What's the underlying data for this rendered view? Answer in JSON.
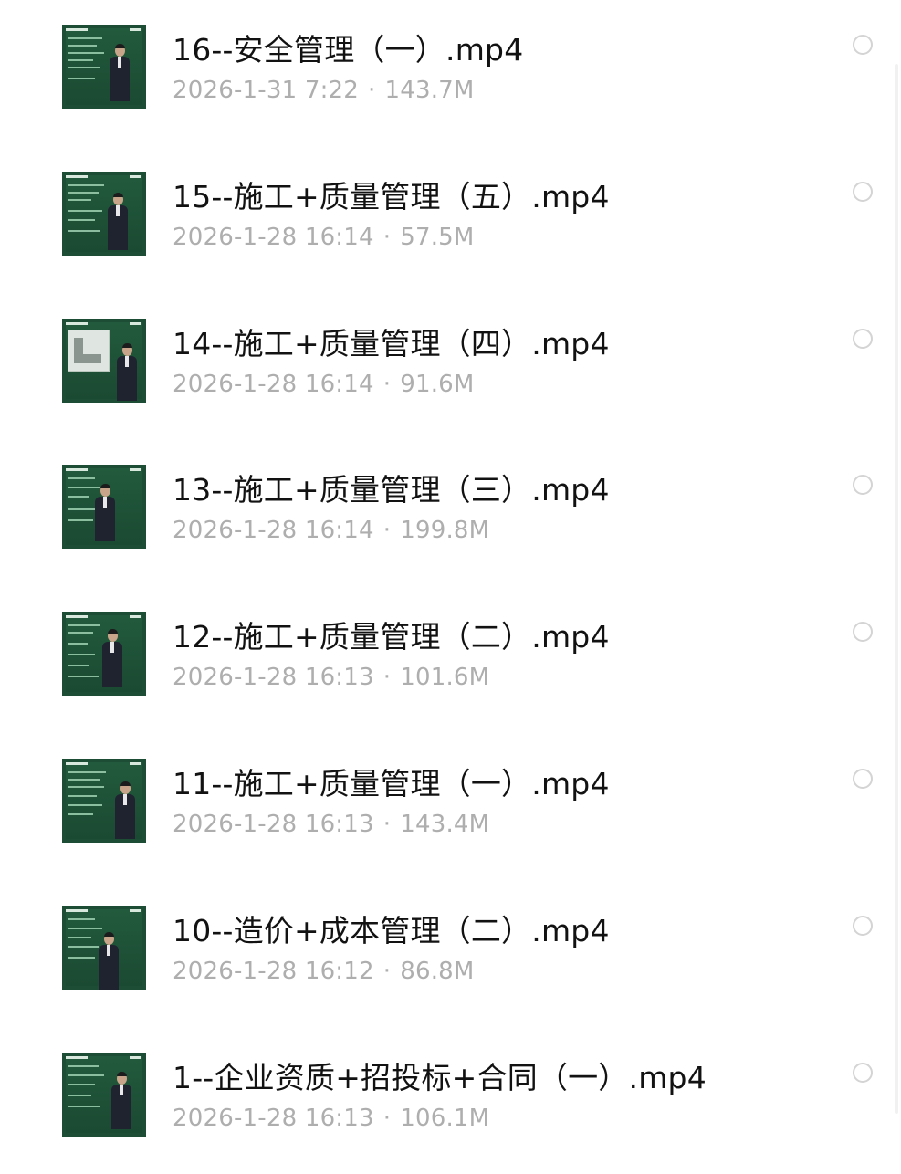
{
  "files": [
    {
      "name": "16--安全管理（一）.mp4",
      "date": "2026-1-31 7:22",
      "size": "143.7M",
      "thumb": "lecture"
    },
    {
      "name": "15--施工+质量管理（五）.mp4",
      "date": "2026-1-28 16:14",
      "size": "57.5M",
      "thumb": "lecture"
    },
    {
      "name": "14--施工+质量管理（四）.mp4",
      "date": "2026-1-28 16:14",
      "size": "91.6M",
      "thumb": "diagram"
    },
    {
      "name": "13--施工+质量管理（三）.mp4",
      "date": "2026-1-28 16:14",
      "size": "199.8M",
      "thumb": "lecture"
    },
    {
      "name": "12--施工+质量管理（二）.mp4",
      "date": "2026-1-28 16:13",
      "size": "101.6M",
      "thumb": "lecture"
    },
    {
      "name": "11--施工+质量管理（一）.mp4",
      "date": "2026-1-28 16:13",
      "size": "143.4M",
      "thumb": "lecture"
    },
    {
      "name": "10--造价+成本管理（二）.mp4",
      "date": "2026-1-28 16:12",
      "size": "86.8M",
      "thumb": "lecture"
    },
    {
      "name": "1--企业资质+招投标+合同（一）.mp4",
      "date": "2026-1-28 16:13",
      "size": "106.1M",
      "thumb": "lecture"
    }
  ],
  "meta_separator": "·",
  "colors": {
    "name_text": "#121212",
    "meta_text": "#aeaeae",
    "thumb_green": "#1d4d34",
    "circle_border": "#d4d4d4"
  },
  "icons": {
    "select": "radio-circle-icon",
    "thumbnail": "video-thumbnail"
  }
}
